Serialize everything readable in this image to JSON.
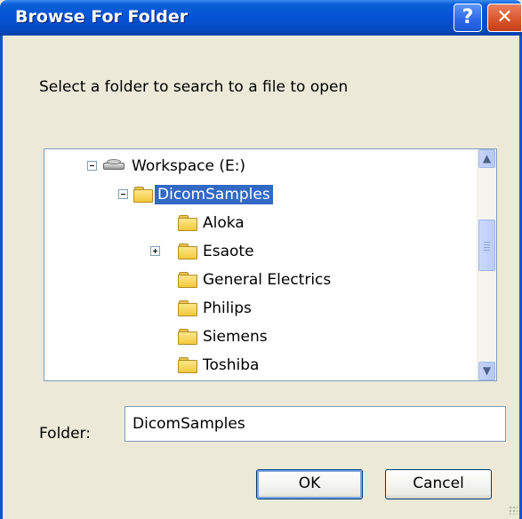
{
  "window": {
    "title": "Browse For Folder",
    "help_glyph": "?",
    "close_glyph": "✕"
  },
  "prompt": "Select a folder to search to a file to open",
  "tree": {
    "items": [
      {
        "label": "Workspace (E:)",
        "icon": "drive-icon",
        "expander": "minus",
        "selected": false
      },
      {
        "label": "DicomSamples",
        "icon": "folder-open-icon",
        "expander": "minus",
        "selected": true
      },
      {
        "label": "Aloka",
        "icon": "folder-icon",
        "expander": "none",
        "selected": false
      },
      {
        "label": "Esaote",
        "icon": "folder-icon",
        "expander": "plus",
        "selected": false
      },
      {
        "label": "General Electrics",
        "icon": "folder-icon",
        "expander": "none",
        "selected": false
      },
      {
        "label": "Philips",
        "icon": "folder-icon",
        "expander": "none",
        "selected": false
      },
      {
        "label": "Siemens",
        "icon": "folder-icon",
        "expander": "none",
        "selected": false
      },
      {
        "label": "Toshiba",
        "icon": "folder-icon",
        "expander": "none",
        "selected": false
      }
    ],
    "scroll_up": "▲",
    "scroll_down": "▼"
  },
  "folder_field": {
    "label": "Folder:",
    "value": "DicomSamples"
  },
  "buttons": {
    "ok": "OK",
    "cancel": "Cancel"
  },
  "colors": {
    "titlebar": "#0453d4",
    "selection": "#316ac5",
    "dialog_bg": "#ece9d8"
  }
}
